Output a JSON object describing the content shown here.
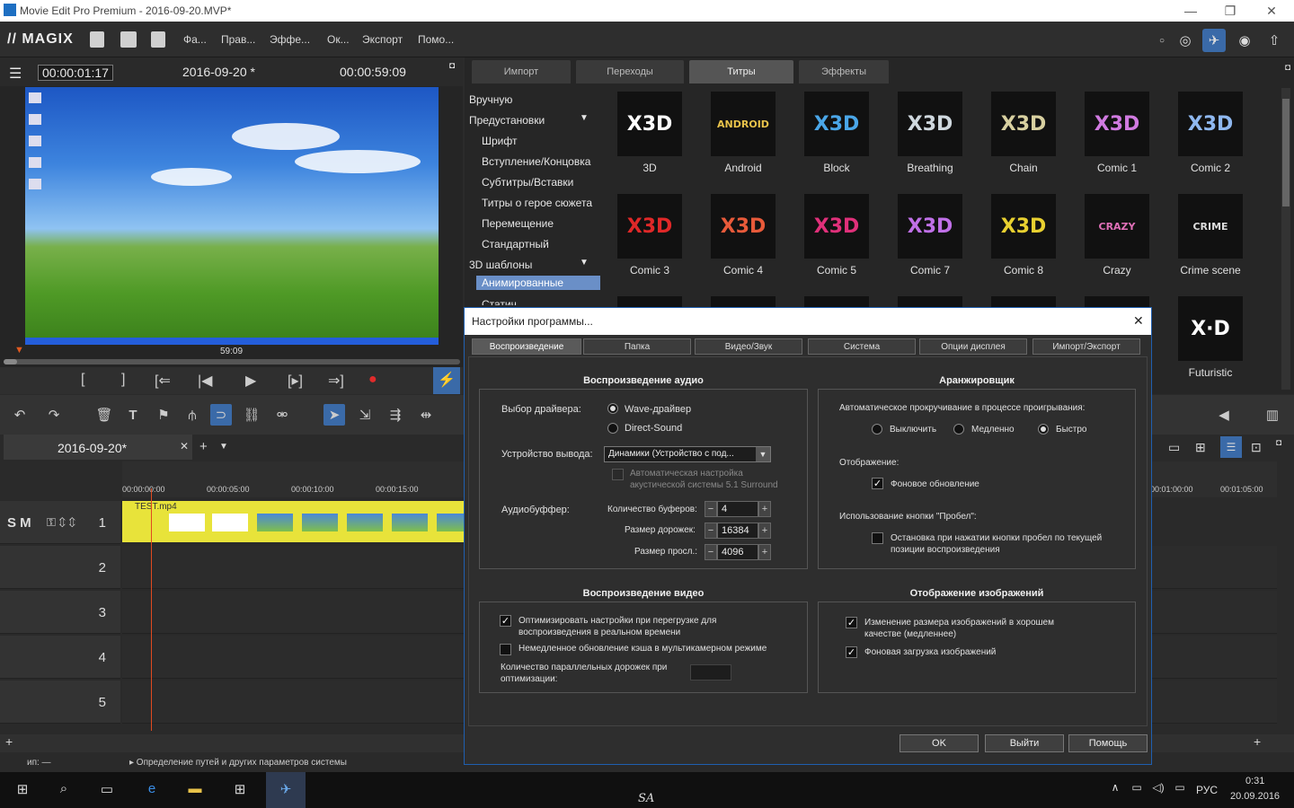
{
  "window": {
    "title": "Movie Edit Pro Premium - 2016-09-20.MVP*",
    "min": "—",
    "max": "❐",
    "close": "✕"
  },
  "menu": {
    "logo": "// MAGIX",
    "items": [
      "Фа...",
      "Прав...",
      "Эффе...",
      "Ок...",
      "Экспорт",
      "Помо..."
    ]
  },
  "preview": {
    "timecode": "00:00:01:17",
    "project": "2016-09-20 *",
    "duration": "00:00:59:09",
    "marker": "59:09",
    "progress": 0.03
  },
  "browser": {
    "tabs": [
      "Импорт",
      "Переходы",
      "Титры",
      "Эффекты"
    ],
    "active_tab": 2,
    "tree": [
      "Вручную",
      "Предустановки",
      "Шрифт",
      "Вступление/Концовка",
      "Субтитры/Вставки",
      "Титры о герое сюжета",
      "Перемещение",
      "Стандартный",
      "3D шаблоны",
      "Анимированные",
      "Статич..."
    ],
    "tiles": [
      {
        "label": "3D",
        "art": "X3D",
        "color": "#ffffff"
      },
      {
        "label": "Android",
        "art": "ANDROID",
        "color": "#e8c24a"
      },
      {
        "label": "Block",
        "art": "X3D",
        "color": "#4aa6e8"
      },
      {
        "label": "Breathing",
        "art": "X3D",
        "color": "#cfd8de"
      },
      {
        "label": "Chain",
        "art": "X3D",
        "color": "#d8d0a0"
      },
      {
        "label": "Comic 1",
        "art": "X3D",
        "color": "#d07ae0"
      },
      {
        "label": "Comic 2",
        "art": "X3D",
        "color": "#8fb8f0"
      },
      {
        "label": "Comic 3",
        "art": "X3D",
        "color": "#e02828"
      },
      {
        "label": "Comic 4",
        "art": "X3D",
        "color": "#e85a3a"
      },
      {
        "label": "Comic 5",
        "art": "X3D",
        "color": "#e0307a"
      },
      {
        "label": "Comic 7",
        "art": "X3D",
        "color": "#c070e8"
      },
      {
        "label": "Comic 8",
        "art": "X3D",
        "color": "#e8d030"
      },
      {
        "label": "Crazy",
        "art": "CRAZY",
        "color": "#e070b8"
      },
      {
        "label": "Crime scene",
        "art": "CRIME",
        "color": "#dddddd"
      },
      {
        "label": "Futuristic",
        "art": "X·D",
        "color": "#ffffff"
      }
    ]
  },
  "timeline": {
    "tab": "2016-09-20*",
    "tracks": [
      "1",
      "2",
      "3",
      "4",
      "5"
    ],
    "clip": "TEST.mp4",
    "ruler": [
      "00:00:00:00",
      "00:00:05:00",
      "00:00:10:00",
      "00:00:15:00",
      "00:01:00:00",
      "00:01:05:00"
    ],
    "track_letters": "S M"
  },
  "status": {
    "left": "ип: —",
    "message": "▸ Определение путей и других параметров системы"
  },
  "taskbar": {
    "lang": "РУС",
    "time": "0:31",
    "date": "20.09.2016",
    "center": "SA"
  },
  "dialog": {
    "title": "Настройки программы...",
    "close": "✕",
    "tabs": [
      "Воспроизведение",
      "Папка",
      "Видео/Звук",
      "Система",
      "Опции дисплея",
      "Импорт/Экспорт"
    ],
    "audio": {
      "heading": "Воспроизведение аудио",
      "driver_label": "Выбор драйвера:",
      "driver_options": [
        "Wave-драйвер",
        "Direct-Sound"
      ],
      "device_label": "Устройство вывода:",
      "device_value": "Динамики (Устройство с под...",
      "surround": "Автоматическая настройка акустической системы 5.1 Surround",
      "buffer_label": "Аудиобуффер:",
      "buffers_label": "Количество буферов:",
      "buffers": "4",
      "track_label": "Размер дорожек:",
      "track_size": "16384",
      "prelisten_label": "Размер просл.:",
      "prelisten": "4096"
    },
    "arranger": {
      "heading": "Аранжировщик",
      "autoscroll": "Автоматическое прокручивание в процессе проигрывания:",
      "options": [
        "Выключить",
        "Медленно",
        "Быстро"
      ],
      "display_label": "Отображение:",
      "bg_update": "Фоновое обновление",
      "space_label": "Использование кнопки \"Пробел\":",
      "space_stop": "Остановка при нажатии кнопки пробел по текущей позиции воспроизведения"
    },
    "video": {
      "heading": "Воспроизведение видео",
      "optimize": "Оптимизировать настройки при перегрузке для воспроизведения в реальном времени",
      "cache": "Немедленное обновление кэша в мультикамерном режиме",
      "parallel": "Количество параллельных дорожек при оптимизации:"
    },
    "images": {
      "heading": "Отображение изображений",
      "resize": "Изменение размера изображений в хорошем качестве (медленнее)",
      "bg_load": "Фоновая загрузка изображений"
    },
    "buttons": {
      "ok": "OK",
      "exit": "Выйти",
      "help": "Помощь"
    }
  }
}
